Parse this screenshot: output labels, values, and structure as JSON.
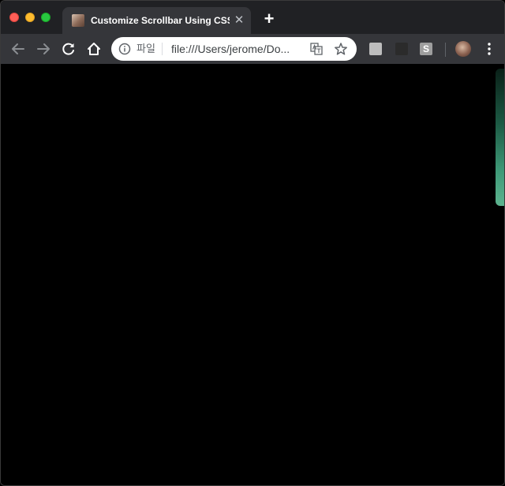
{
  "window": {
    "controls": [
      "close",
      "minimize",
      "zoom"
    ]
  },
  "tab": {
    "title": "Customize Scrollbar Using CSS",
    "close_symbol": "✕",
    "favicon_icon": "page-favicon"
  },
  "newtab": {
    "symbol": "+"
  },
  "toolbar": {
    "icons": [
      "back-arrow-icon",
      "forward-arrow-icon",
      "reload-icon",
      "home-icon"
    ]
  },
  "omnibox": {
    "security_chip": "파일",
    "url": "file:///Users/jerome/Do...",
    "icons": [
      "info-icon",
      "translate-icon",
      "star-icon"
    ]
  },
  "extensions": {
    "ext3_label": "S",
    "icons": [
      "extension-1-icon",
      "extension-2-icon",
      "extension-s-icon"
    ]
  },
  "profile": {
    "icon": "profile-avatar"
  },
  "menu": {
    "icon": "more-vert-icon"
  },
  "colors": {
    "titlebar": "#202124",
    "toolbar": "#35363a",
    "page_bg": "#000000",
    "scroll_thumb": "#5db38f"
  }
}
